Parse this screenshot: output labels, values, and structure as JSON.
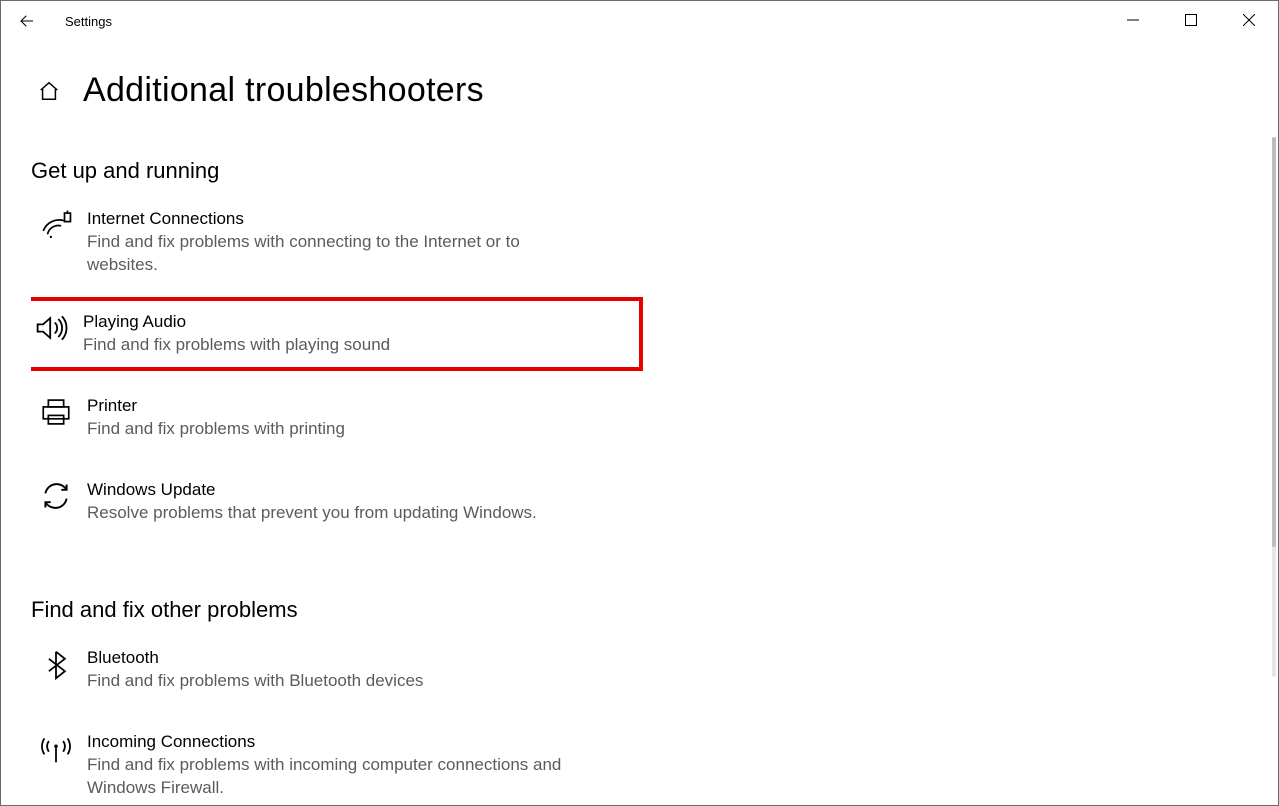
{
  "app_title": "Settings",
  "page_title": "Additional troubleshooters",
  "section1_title": "Get up and running",
  "section2_title": "Find and fix other problems",
  "items": {
    "internet": {
      "title": "Internet Connections",
      "desc": "Find and fix problems with connecting to the Internet or to websites."
    },
    "audio": {
      "title": "Playing Audio",
      "desc": "Find and fix problems with playing sound"
    },
    "printer": {
      "title": "Printer",
      "desc": "Find and fix problems with printing"
    },
    "update": {
      "title": "Windows Update",
      "desc": "Resolve problems that prevent you from updating Windows."
    },
    "bluetooth": {
      "title": "Bluetooth",
      "desc": "Find and fix problems with Bluetooth devices"
    },
    "incoming": {
      "title": "Incoming Connections",
      "desc": "Find and fix problems with incoming computer connections and Windows Firewall."
    }
  }
}
